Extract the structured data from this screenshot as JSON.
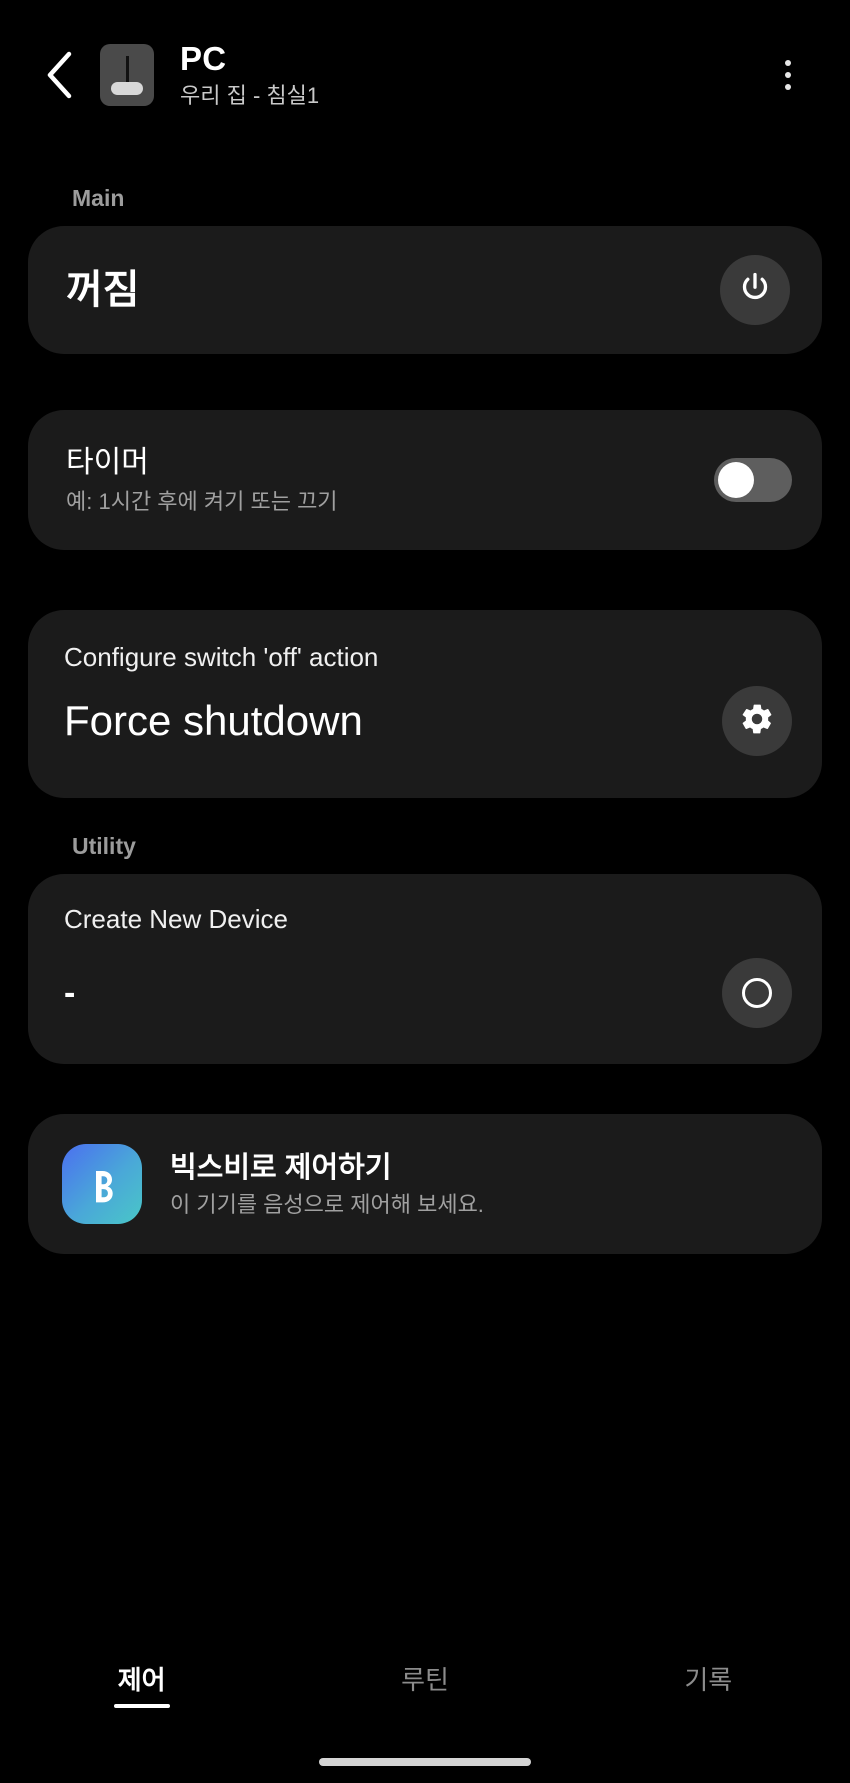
{
  "header": {
    "back_icon": "chevron-left-icon",
    "device_icon": "switch-device-icon",
    "title": "PC",
    "subtitle": "우리 집 - 침실1",
    "more_icon": "more-vertical-icon"
  },
  "sections": {
    "main_label": "Main",
    "utility_label": "Utility"
  },
  "power_card": {
    "state": "꺼짐",
    "button_icon": "power-icon"
  },
  "timer_card": {
    "title": "타이머",
    "subtitle": "예: 1시간 후에 켜기 또는 끄기",
    "toggle_state": "off"
  },
  "action_card": {
    "label": "Configure switch 'off' action",
    "value": "Force shutdown",
    "button_icon": "gear-icon"
  },
  "utility_card": {
    "label": "Create New Device",
    "value": "-",
    "button_icon": "circle-outline-icon"
  },
  "bixby_card": {
    "logo_icon": "bixby-logo-icon",
    "title": "빅스비로 제어하기",
    "subtitle": "이 기기를 음성으로 제어해 보세요."
  },
  "bottom_nav": {
    "tabs": [
      {
        "label": "제어",
        "active": true
      },
      {
        "label": "루틴",
        "active": false
      },
      {
        "label": "기록",
        "active": false
      }
    ]
  },
  "colors": {
    "background": "#000000",
    "card": "#1b1b1b",
    "accent_circle": "#3a3a3a",
    "text_primary": "#ffffff",
    "text_secondary": "#a0a0a0",
    "section_label": "#9c9c9c",
    "toggle_track_off": "#5e5e5e",
    "toggle_knob": "#ffffff",
    "bixby_gradient_start": "#4b6ff0",
    "bixby_gradient_end": "#49c7c7"
  }
}
